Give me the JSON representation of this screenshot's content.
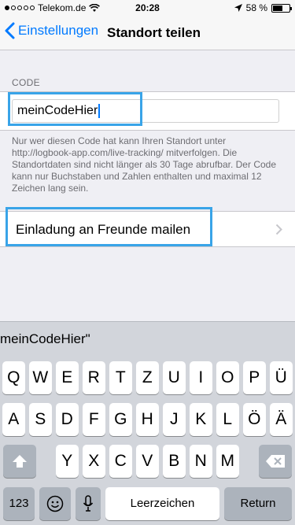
{
  "status_bar": {
    "carrier": "Telekom.de",
    "time": "20:28",
    "battery_percent": "58 %",
    "battery_level": 0.58
  },
  "nav": {
    "back_label": "Einstellungen",
    "title": "Standort teilen"
  },
  "code_section": {
    "header": "CODE",
    "input_value": "meinCodeHier",
    "footnote": "Nur wer diesen Code hat kann Ihren Standort unter http://logbook-app.com/live-tracking/ mitverfolgen. Die Standortdaten sind nicht länger als 30 Tage abrufbar. Der Code kann nur Buchstaben und Zahlen enthalten und maximal 12 Zeichen lang sein."
  },
  "invite": {
    "label": "Einladung an Freunde mailen"
  },
  "keyboard": {
    "suggestion": "meinCodeHier\"",
    "row1": [
      "Q",
      "W",
      "E",
      "R",
      "T",
      "Z",
      "U",
      "I",
      "O",
      "P",
      "Ü"
    ],
    "row2": [
      "A",
      "S",
      "D",
      "F",
      "G",
      "H",
      "J",
      "K",
      "L",
      "Ö",
      "Ä"
    ],
    "row3": [
      "Y",
      "X",
      "C",
      "V",
      "B",
      "N",
      "M"
    ],
    "numbers_key": "123",
    "space_key": "Leerzeichen",
    "return_key": "Return"
  },
  "colors": {
    "accent": "#007aff",
    "highlight": "#39a4e8"
  }
}
